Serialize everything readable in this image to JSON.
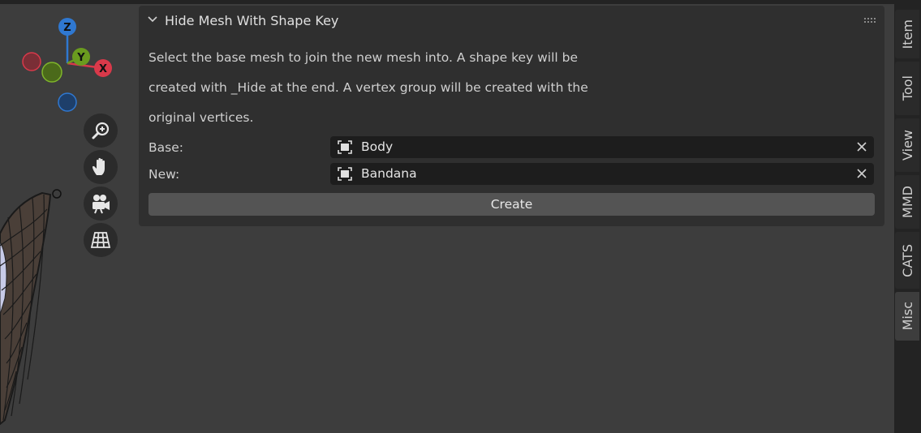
{
  "gizmo": {
    "x_label": "X",
    "y_label": "Y",
    "z_label": "Z"
  },
  "panel": {
    "title": "Hide Mesh With Shape Key",
    "description_lines": [
      "Select the base mesh to join the new mesh into. A shape key will be",
      "created with _Hide at the end. A vertex group will be created with the",
      "original vertices."
    ],
    "base_label": "Base:",
    "base_value": "Body",
    "new_label": "New:",
    "new_value": "Bandana",
    "create_label": "Create"
  },
  "tabs": [
    "Item",
    "Tool",
    "View",
    "MMD",
    "CATS",
    "Misc"
  ],
  "active_tab": "Misc",
  "colors": {
    "x_axis": "#d9394a",
    "y_axis": "#6a9b1f",
    "z_axis": "#2f78d1",
    "panel_bg": "#2f2f2f",
    "field_bg": "#1d1d1d",
    "button_bg": "#545454"
  },
  "icons": {
    "collapse": "chevron-down-icon",
    "drag": "grip-icon",
    "zoom": "zoom-icon",
    "pan": "hand-icon",
    "camera": "camera-icon",
    "perspective": "grid-icon",
    "object": "object-icon",
    "clear": "close-icon"
  }
}
